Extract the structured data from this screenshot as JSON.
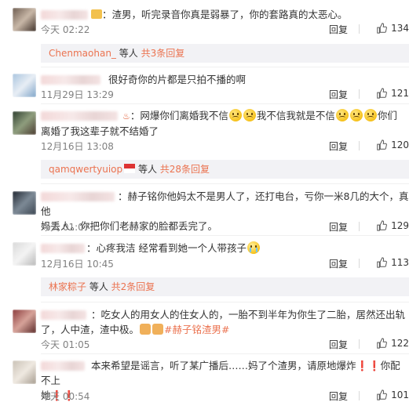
{
  "comments": [
    {
      "user_suffix": "：",
      "text": "渣男，听完录音你真是弱暴了，你的套路真的太恶心。",
      "time": "今天 02:22",
      "reply": "回复",
      "likes": "134",
      "sub_replies": {
        "name": "Chenmaohan_",
        "mid": " 等人 ",
        "count": "共3条回复"
      }
    },
    {
      "user_suffix": "",
      "text": "很好奇你的片都是只拍不播的啊",
      "time": "11月29日 13:29",
      "reply": "回复",
      "likes": "121"
    },
    {
      "user_suffix": "：",
      "text_a": "网爆你们离婚我不信",
      "text_b": "我不信我就是不信",
      "text_c": "你们",
      "text_d": "离婚了我这辈子就不结婚了",
      "time": "12月16日 13:08",
      "reply": "回复",
      "likes": "120",
      "sub_replies": {
        "name": "qamqwertyuiop",
        "mid": " 等人 ",
        "count": "共28条回复"
      }
    },
    {
      "user_suffix": "：",
      "text_a": "赫子铭你他妈太不是男人了，还打电台，亏你一米8几的大个，真他",
      "text_b": "妈丢人。你把你们老赫家的脸都丢完了。",
      "time": "今天 01:07",
      "reply": "回复",
      "likes": "129"
    },
    {
      "user_suffix": "：",
      "text": "心疼我洁 经常看到她一个人带孩子",
      "time": "12月16日 10:45",
      "reply": "回复",
      "likes": "113",
      "sub_replies": {
        "name": "林家粽子",
        "mid": " 等人 ",
        "count": "共2条回复"
      }
    },
    {
      "user_suffix": "：",
      "text_a": "吃女人的用女人的住女人的，一胎不到半年为你生了二胎，居然还出轨",
      "text_b": "了，人中渣，渣中极。",
      "tag": "#赫子铭渣男#",
      "time": "今天 01:05",
      "reply": "回复",
      "likes": "122"
    },
    {
      "user_suffix": "：",
      "text_a": "本来希望是谣言，听了某广播后……妈了个渣男，请原地爆炸❗❗你配不上",
      "text_b": "她❗❗",
      "time": "今天 00:54",
      "reply": "回复",
      "likes": "101"
    }
  ]
}
